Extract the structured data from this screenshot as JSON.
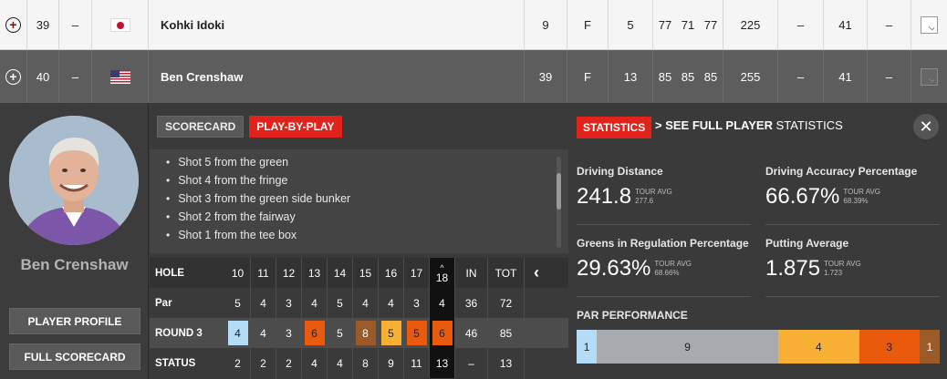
{
  "leaderboard": [
    {
      "pos": "39",
      "move": "–",
      "country": "JPN",
      "name": "Kohki Idoki",
      "to_par": "9",
      "thru": "F",
      "today": "5",
      "r1": "77",
      "r2": "71",
      "r3": "77",
      "total": "225",
      "col1": "–",
      "col2": "41",
      "col3": "–"
    },
    {
      "pos": "40",
      "move": "–",
      "country": "USA",
      "name": "Ben Crenshaw",
      "to_par": "39",
      "thru": "F",
      "today": "13",
      "r1": "85",
      "r2": "85",
      "r3": "85",
      "total": "255",
      "col1": "–",
      "col2": "41",
      "col3": "–"
    }
  ],
  "player": {
    "name": "Ben Crenshaw",
    "profile_label": "PLAYER PROFILE",
    "full_scorecard_label": "FULL SCORECARD"
  },
  "tabs": {
    "scorecard": "SCORECARD",
    "playbyplay": "PLAY-BY-PLAY"
  },
  "shots": [
    "Shot 5 from the green",
    "Shot 4 from the fringe",
    "Shot 3 from the green side bunker",
    "Shot 2 from the fairway",
    "Shot 1 from the tee box"
  ],
  "scorecard": {
    "labels": {
      "hole": "HOLE",
      "par": "Par",
      "round": "ROUND 3",
      "status": "STATUS",
      "in": "IN",
      "tot": "TOT"
    },
    "holes": [
      "10",
      "11",
      "12",
      "13",
      "14",
      "15",
      "16",
      "17",
      "18"
    ],
    "par": [
      "5",
      "4",
      "3",
      "4",
      "5",
      "4",
      "4",
      "3",
      "4"
    ],
    "par_in": "36",
    "par_tot": "72",
    "round": [
      "4",
      "4",
      "3",
      "6",
      "5",
      "8",
      "5",
      "5",
      "6"
    ],
    "round_in": "46",
    "round_tot": "85",
    "status": [
      "2",
      "2",
      "2",
      "4",
      "4",
      "8",
      "9",
      "11",
      "13"
    ],
    "status_in": "–",
    "status_tot": "13",
    "nav_glyph": "‹",
    "current_glyph": "^"
  },
  "stats": {
    "tab": "STATISTICS",
    "link_prefix": "> SEE FULL PLAYER",
    "link_suffix": " STATISTICS",
    "close_glyph": "✕",
    "items": [
      {
        "title": "Driving Distance",
        "value": "241.8",
        "avg_label": "TOUR AVG",
        "avg": "277.6"
      },
      {
        "title": "Driving Accuracy Percentage",
        "value": "66.67%",
        "avg_label": "TOUR AVG",
        "avg": "68.39%"
      },
      {
        "title": "Greens in Regulation Percentage",
        "value": "29.63%",
        "avg_label": "TOUR AVG",
        "avg": "68.66%"
      },
      {
        "title": "Putting Average",
        "value": "1.875",
        "avg_label": "TOUR AVG",
        "avg": "1.723"
      }
    ],
    "par_performance_title": "PAR PERFORMANCE",
    "par_performance": [
      {
        "label": "1",
        "count": 1,
        "color": "#b5dcf7"
      },
      {
        "label": "9",
        "count": 9,
        "color": "#a8abae"
      },
      {
        "label": "4",
        "count": 4,
        "color": "#f7b034"
      },
      {
        "label": "3",
        "count": 3,
        "color": "#ea5a0c"
      },
      {
        "label": "1",
        "count": 1,
        "color": "#9c5a28"
      }
    ]
  }
}
